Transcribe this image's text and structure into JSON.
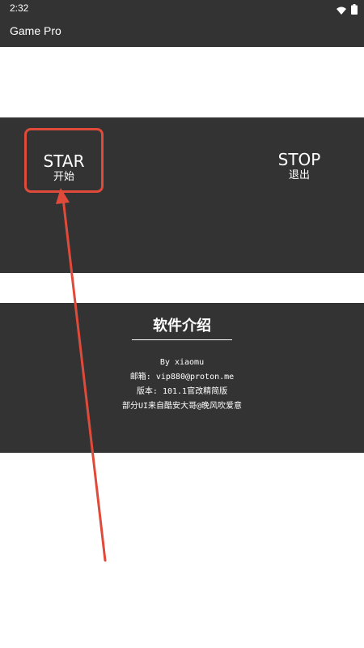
{
  "status_bar": {
    "time": "2:32",
    "icons": [
      "wifi-icon",
      "battery-icon"
    ]
  },
  "app_bar": {
    "title": "Game Pro"
  },
  "controls": {
    "start_label": "STAR",
    "start_sub": "开始",
    "stop_label": "STOP",
    "stop_sub": "退出"
  },
  "info": {
    "title": "软件介绍",
    "lines": [
      "By xiaomu",
      "邮箱: vip880@proton.me",
      "版本: 101.1官改精简版",
      "部分UI来自酷安大哥@晚风吹爱意"
    ]
  },
  "colors": {
    "bar": "#333333",
    "panel": "#333333",
    "highlight": "#e04a3a"
  }
}
